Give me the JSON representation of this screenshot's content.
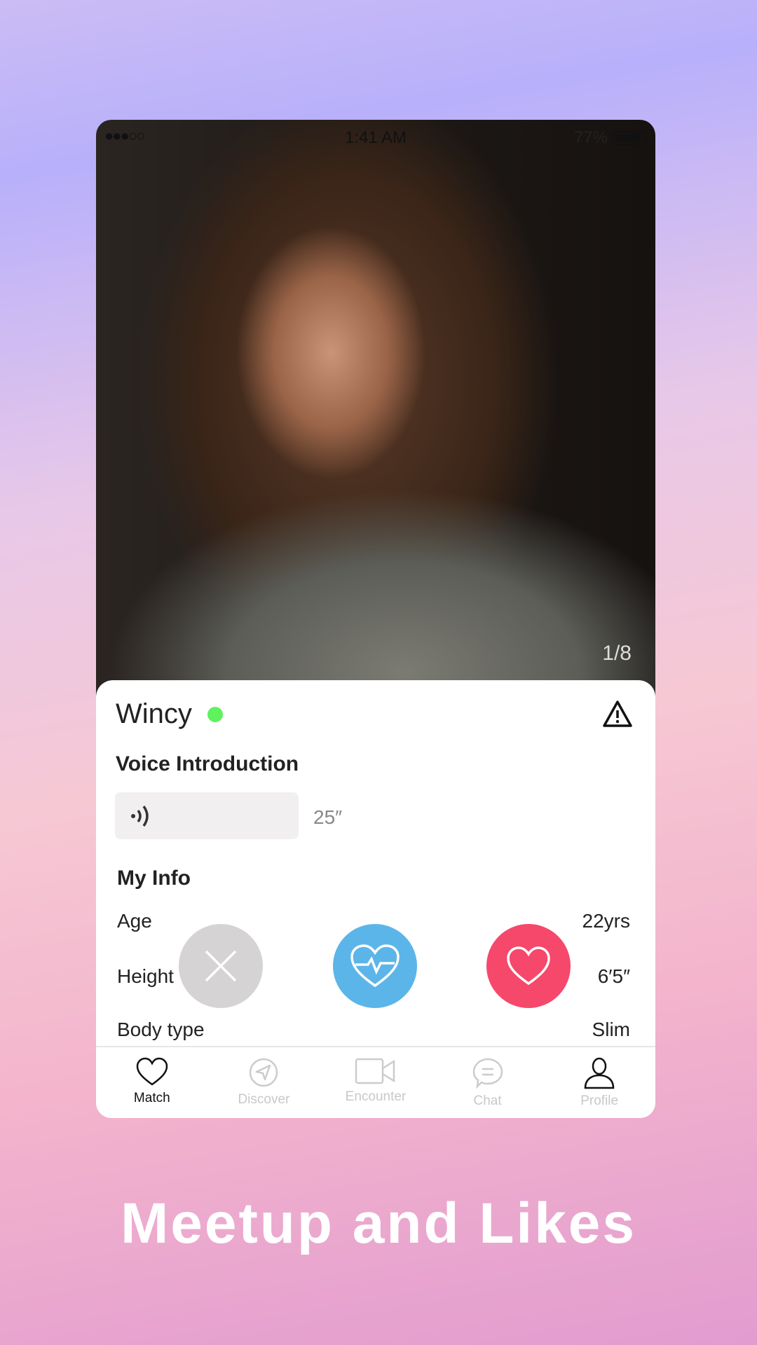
{
  "status_bar": {
    "time": "1:41 AM",
    "battery": "77%",
    "signal": "●●●○○"
  },
  "photo": {
    "pager": "1/8"
  },
  "profile": {
    "name": "Wincy",
    "online": true,
    "online_color": "#5ff25f"
  },
  "voice": {
    "heading": "Voice Introduction",
    "duration": "25″"
  },
  "info": {
    "heading": "My Info",
    "rows": [
      {
        "label": "Age",
        "value": "22yrs"
      },
      {
        "label": "Height",
        "value": "6′5″"
      },
      {
        "label": "Body type",
        "value": "Slim"
      }
    ]
  },
  "actions": {
    "dislike_color": "#d5d3d3",
    "superlike_color": "#5cb5e8",
    "like_color": "#f5486b"
  },
  "nav": [
    {
      "label": "Match",
      "icon": "heart-icon",
      "active": true
    },
    {
      "label": "Discover",
      "icon": "navigation-icon"
    },
    {
      "label": "Encounter",
      "icon": "video-icon"
    },
    {
      "label": "Chat",
      "icon": "chat-icon"
    },
    {
      "label": "Profile",
      "icon": "person-icon"
    }
  ],
  "tagline": "Meetup and Likes"
}
